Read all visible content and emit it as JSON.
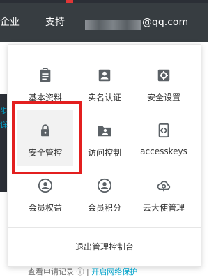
{
  "topbar": {
    "nav_biz": "企业",
    "nav_support": "支持",
    "email_suffix": "@qq.com"
  },
  "menu": {
    "items": [
      {
        "label": "基本资料",
        "icon": "id-card-icon"
      },
      {
        "label": "实名认证",
        "icon": "person-badge-icon"
      },
      {
        "label": "安全设置",
        "icon": "gear-icon"
      },
      {
        "label": "安全管控",
        "icon": "lock-icon"
      },
      {
        "label": "访问控制",
        "icon": "user-folder-icon"
      },
      {
        "label": "accesskeys",
        "icon": "code-icon"
      },
      {
        "label": "会员权益",
        "icon": "member-icon"
      },
      {
        "label": "会员积分",
        "icon": "member-points-icon"
      },
      {
        "label": "云大使管理",
        "icon": "cloud-icon"
      }
    ],
    "logout_label": "退出管理控制台"
  },
  "background": {
    "left_chars": [
      "步",
      "详"
    ],
    "bottom_prefix": "查看申请记录",
    "bottom_link": "开启网络保护"
  },
  "colors": {
    "topbar": "#373d41",
    "icon": "#5b6166",
    "highlight": "#e31f1f",
    "link": "#00a2ca"
  }
}
